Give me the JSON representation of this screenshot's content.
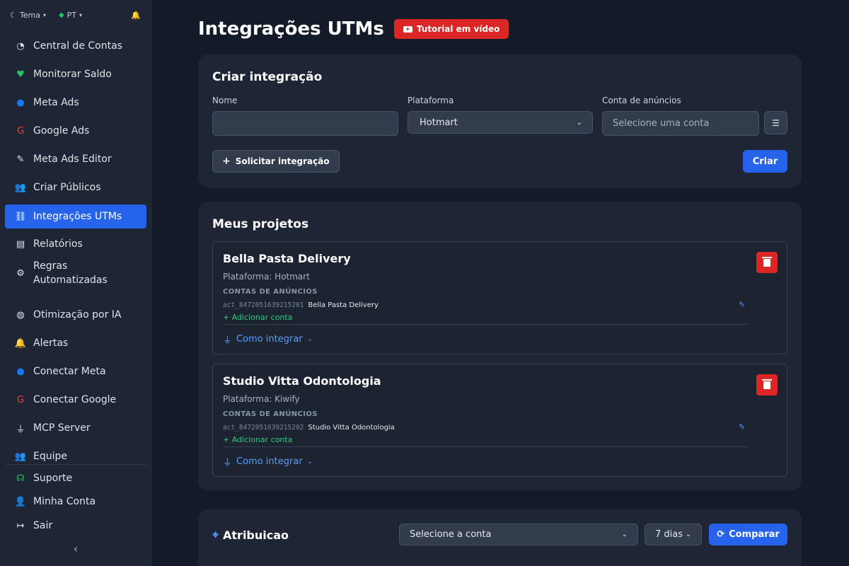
{
  "sidebar": {
    "theme_label": "Tema",
    "lang_label": "PT",
    "items": [
      {
        "label": "Central de Contas",
        "icon": "pie-chart-icon",
        "glyph": "◔",
        "color": "#dfe3ea"
      },
      {
        "label": "Monitorar Saldo",
        "icon": "heart-pulse-icon",
        "glyph": "♥",
        "color": "#22c55e"
      },
      {
        "label": "Meta Ads",
        "icon": "facebook-icon",
        "glyph": "●",
        "color": "#1877f2"
      },
      {
        "label": "Google Ads",
        "icon": "google-icon",
        "glyph": "G",
        "color": "#ea4335"
      },
      {
        "label": "Meta Ads Editor",
        "icon": "edit-icon",
        "glyph": "✎",
        "color": "#dfe3ea"
      },
      {
        "label": "Criar Públicos",
        "icon": "users-icon",
        "glyph": "👥",
        "color": "#dfe3ea"
      },
      {
        "label": "Integrações UTMs",
        "icon": "network-icon",
        "glyph": "⛓",
        "color": "#ffffff"
      },
      {
        "label": "Relatórios",
        "icon": "file-icon",
        "glyph": "▤",
        "color": "#dfe3ea"
      },
      {
        "label": "Regras Automatizadas",
        "icon": "robot-icon",
        "glyph": "⚙",
        "color": "#dfe3ea"
      },
      {
        "label": "Otimização por IA",
        "icon": "brain-icon",
        "glyph": "◍",
        "color": "#dfe3ea"
      },
      {
        "label": "Alertas",
        "icon": "bell-icon",
        "glyph": "🔔",
        "color": "#dfe3ea"
      },
      {
        "label": "Conectar Meta",
        "icon": "facebook-icon",
        "glyph": "●",
        "color": "#1877f2"
      },
      {
        "label": "Conectar Google",
        "icon": "google-icon",
        "glyph": "G",
        "color": "#ea4335"
      },
      {
        "label": "MCP Server",
        "icon": "plug-icon",
        "glyph": "⏚",
        "color": "#dfe3ea"
      },
      {
        "label": "Equipe",
        "icon": "team-icon",
        "glyph": "👥",
        "color": "#dfe3ea"
      }
    ],
    "bottom": [
      {
        "label": "Suporte",
        "icon": "headset-icon",
        "glyph": "☊",
        "color": "#22c55e"
      },
      {
        "label": "Minha Conta",
        "icon": "user-icon",
        "glyph": "👤",
        "color": "#dfe3ea"
      },
      {
        "label": "Sair",
        "icon": "logout-icon",
        "glyph": "↦",
        "color": "#dfe3ea"
      }
    ]
  },
  "header": {
    "title": "Integrações UTMs",
    "tutorial_label": "Tutorial em vídeo"
  },
  "create": {
    "title": "Criar integração",
    "name_label": "Nome",
    "name_value": "",
    "platform_label": "Plataforma",
    "platform_value": "Hotmart",
    "account_label": "Conta de anúncios",
    "account_placeholder": "Selecione uma conta",
    "request_label": "Solicitar integração",
    "create_label": "Criar"
  },
  "projects": {
    "title": "Meus projetos",
    "items": [
      {
        "name": "Bella Pasta Delivery",
        "platform": "Plataforma: Hotmart",
        "accounts_label": "CONTAS DE ANÚNCIOS",
        "account_id": "act_8472051639215201",
        "account_name": "Bella Pasta Delivery",
        "add_account": "+ Adicionar conta",
        "how_label": "Como integrar"
      },
      {
        "name": "Studio Vitta Odontologia",
        "platform": "Plataforma: Kiwify",
        "accounts_label": "CONTAS DE ANÚNCIOS",
        "account_id": "act_8472051639215202",
        "account_name": "Studio Vitta Odontologia",
        "add_account": "+ Adicionar conta",
        "how_label": "Como integrar"
      }
    ]
  },
  "attribution": {
    "title": "Atribuicao",
    "account_select": "Selecione a conta",
    "period_select": "7 dias",
    "compare_label": "Comparar"
  }
}
